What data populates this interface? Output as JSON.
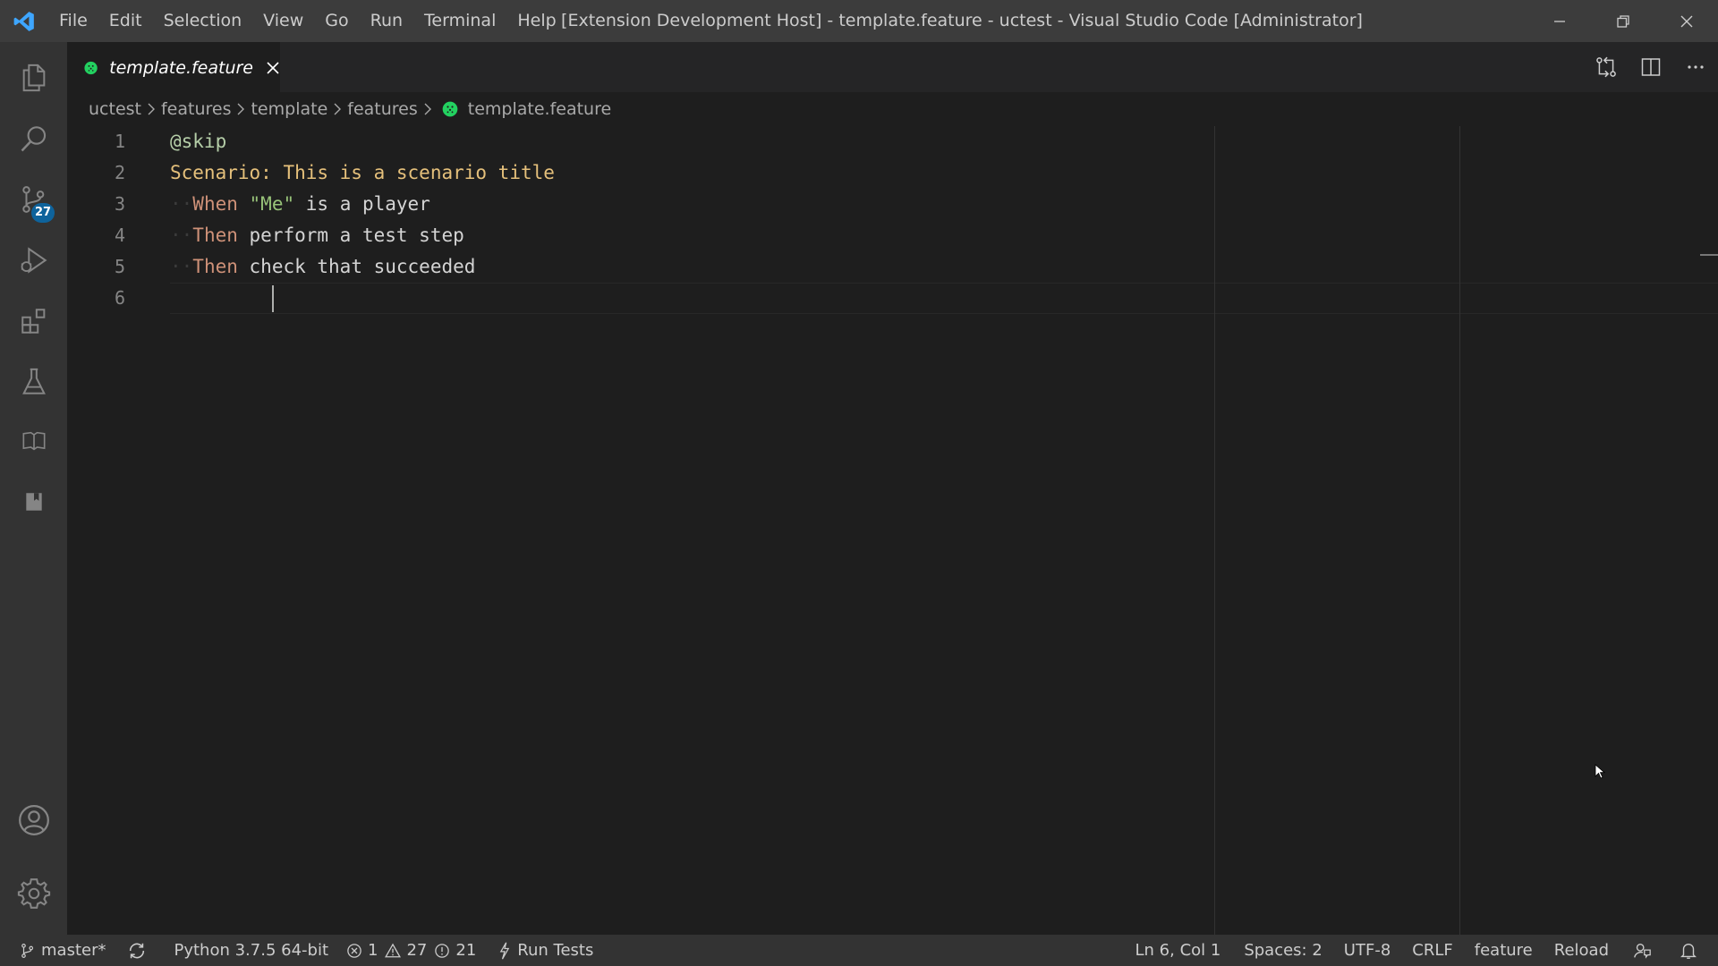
{
  "titlebar": {
    "menu": [
      "File",
      "Edit",
      "Selection",
      "View",
      "Go",
      "Run",
      "Terminal",
      "Help"
    ],
    "window_title": "[Extension Development Host] - template.feature - uctest - Visual Studio Code [Administrator]"
  },
  "activitybar": {
    "scm_badge": "27"
  },
  "tab": {
    "label": "template.feature"
  },
  "breadcrumb": [
    "uctest",
    "features",
    "template",
    "features",
    "template.feature"
  ],
  "editor": {
    "line_numbers": [
      "1",
      "2",
      "3",
      "4",
      "5",
      "6"
    ],
    "lines": {
      "l1": {
        "tag": "@skip"
      },
      "l2": {
        "keyword": "Scenario:",
        "text": "This is a scenario title"
      },
      "l3": {
        "keyword": "When",
        "string": "\"Me\"",
        "text": "is a player"
      },
      "l4": {
        "keyword": "Then",
        "text": "perform a test step"
      },
      "l5": {
        "keyword": "Then",
        "text": "check that succeeded"
      }
    }
  },
  "statusbar": {
    "branch": "master*",
    "python": "Python 3.7.5 64-bit",
    "errors": "1",
    "warnings": "27",
    "infos": "21",
    "run_tests": "Run Tests",
    "position": "Ln 6, Col 1",
    "spaces": "Spaces: 2",
    "encoding": "UTF-8",
    "eol": "CRLF",
    "language": "feature",
    "reload": "Reload"
  },
  "colors": {
    "accent": "#0e639c",
    "cucumber": "#23d160"
  }
}
